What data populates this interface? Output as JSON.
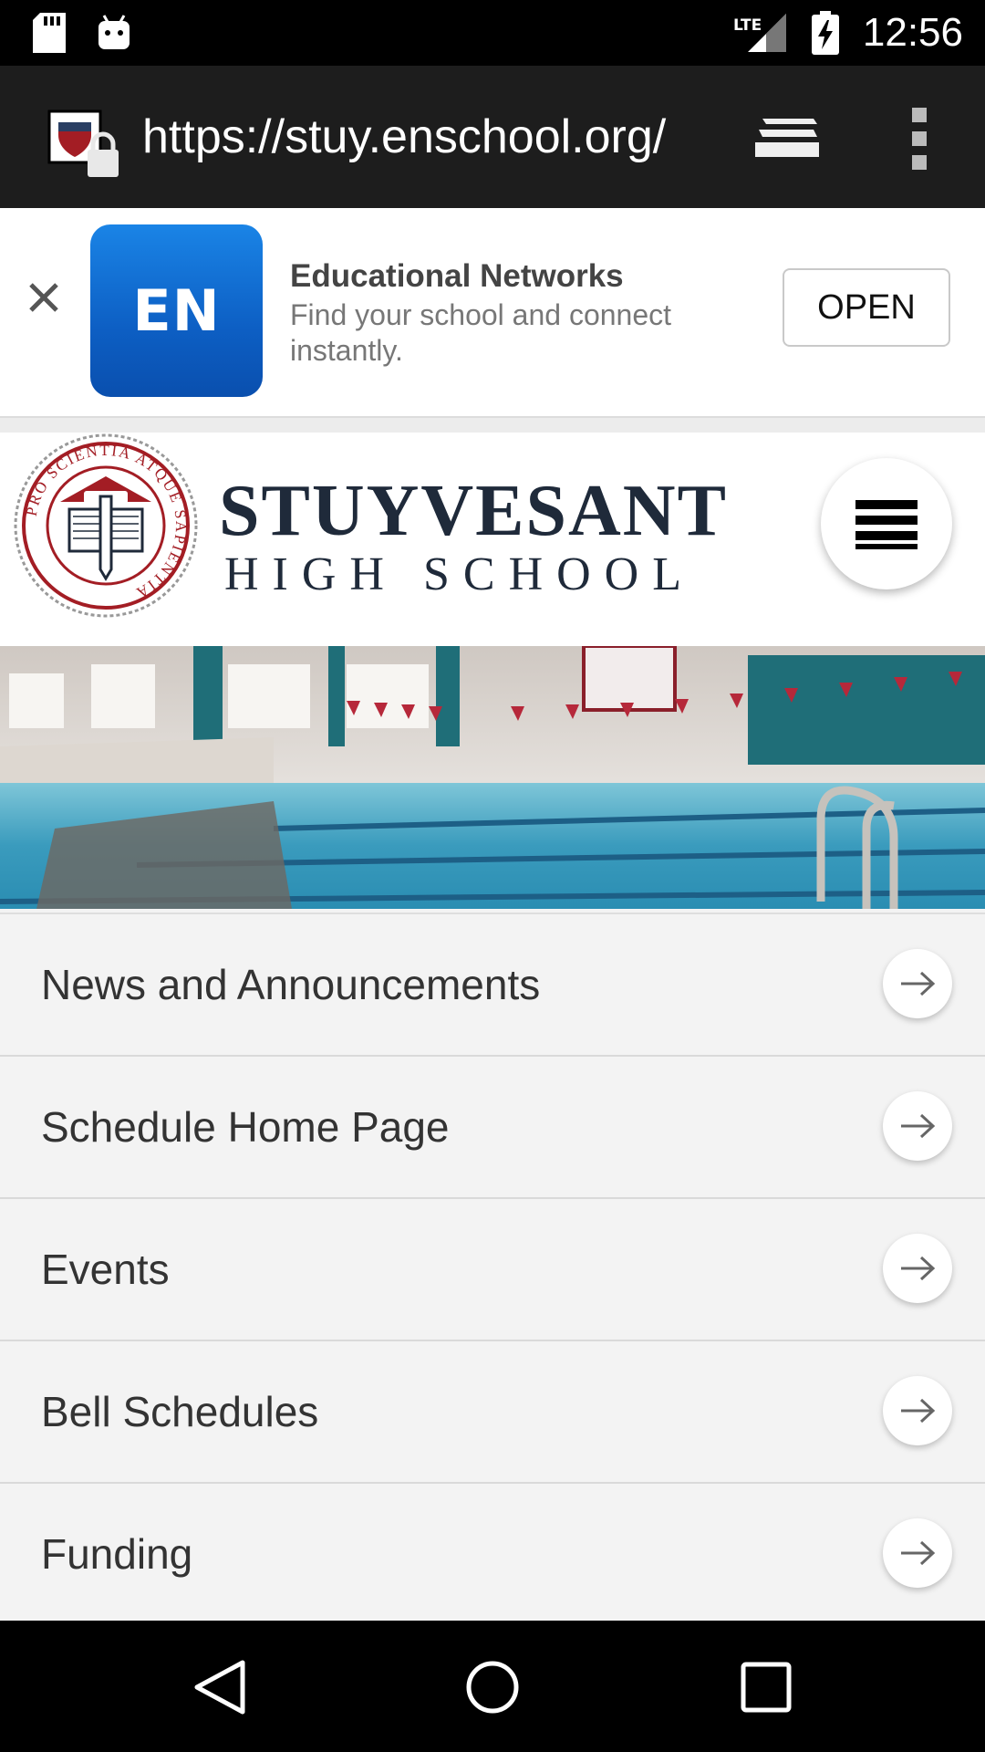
{
  "status_bar": {
    "time": "12:56",
    "network_label": "LTE",
    "icons": [
      "sd-card-icon",
      "android-icon",
      "lte-signal-icon",
      "battery-charging-icon"
    ]
  },
  "browser": {
    "url": "https://stuy.enschool.org/",
    "icons": [
      "secure-site-icon",
      "tab-switcher-icon",
      "overflow-menu-icon"
    ]
  },
  "app_banner": {
    "icon_text": "EN",
    "app_name": "Educational Networks",
    "description": "Find your school and connect instantly.",
    "open_label": "OPEN",
    "accent_color": "#1272d8"
  },
  "site_header": {
    "school_name": "STUYVESANT",
    "school_subtitle": "HIGH SCHOOL",
    "seal_text": "PRO SCIENTIA ATQUE SAPIENTIA",
    "seal_colors": [
      "#a31d24",
      "#1f2a3a"
    ]
  },
  "hero": {
    "description_icon": "swimming-pool-photo"
  },
  "nav_items": [
    {
      "label": "News and Announcements"
    },
    {
      "label": "Schedule Home Page"
    },
    {
      "label": "Events"
    },
    {
      "label": "Bell Schedules"
    },
    {
      "label": "Funding"
    }
  ],
  "system_nav": {
    "icons": [
      "back-icon",
      "home-icon",
      "recents-icon"
    ]
  }
}
